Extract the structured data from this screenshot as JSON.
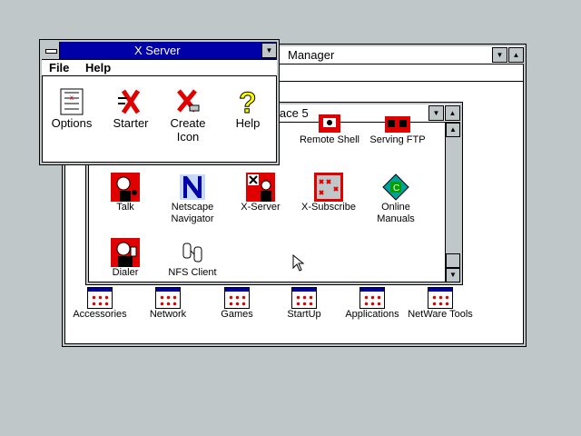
{
  "program_manager": {
    "title": "Manager",
    "groups": [
      "Accessories",
      "Network",
      "Games",
      "StartUp",
      "Applications",
      "NetWare Tools"
    ]
  },
  "workplace": {
    "title": "lace 5",
    "icons": [
      {
        "label": "Remote Shell",
        "icon": "remote-shell-icon"
      },
      {
        "label": "Serving FTP",
        "icon": "serving-ftp-icon"
      },
      {
        "label": "Talk",
        "icon": "talk-icon"
      },
      {
        "label": "Netscape",
        "label2": "Navigator",
        "icon": "netscape-icon"
      },
      {
        "label": "X-Server",
        "icon": "x-server-icon"
      },
      {
        "label": "X-Subscribe",
        "icon": "x-subscribe-icon"
      },
      {
        "label": "Online",
        "label2": "Manuals",
        "icon": "manuals-icon"
      },
      {
        "label": "Dialer",
        "icon": "dialer-icon"
      },
      {
        "label": "NFS Client",
        "icon": "nfs-client-icon"
      }
    ]
  },
  "xserver": {
    "title": "X Server",
    "menu": {
      "file": "File",
      "help": "Help"
    },
    "buttons": [
      {
        "label": "Options"
      },
      {
        "label": "Starter"
      },
      {
        "label": "Create",
        "label2": "Icon"
      },
      {
        "label": "Help"
      }
    ]
  },
  "colors": {
    "active_title": "#0000a8",
    "desktop": "#c0c7c8",
    "icon_red": "#e00000"
  }
}
